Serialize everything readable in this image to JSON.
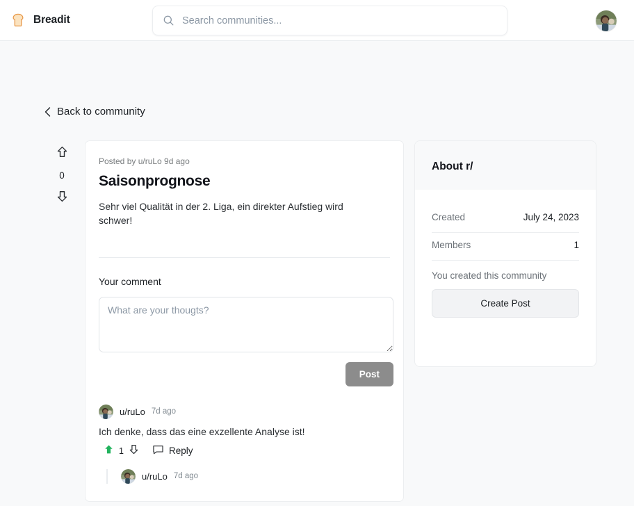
{
  "header": {
    "brand_name": "Breadit",
    "brand_icon": "bread-slice-icon",
    "search_placeholder": "Search communities...",
    "search_value": "",
    "search_icon": "search-icon",
    "avatar": "user-avatar"
  },
  "nav": {
    "back_label": "Back to community",
    "back_icon": "chevron-left-icon"
  },
  "post": {
    "vote_count": "0",
    "upvote_icon": "arrow-up-icon",
    "downvote_icon": "arrow-down-icon",
    "meta": "Posted by u/ruLo 9d ago",
    "title": "Saisonprognose",
    "body": "Sehr viel Qualität in der 2. Liga, ein direkter Aufstieg wird schwer!"
  },
  "comment_form": {
    "label": "Your comment",
    "placeholder": "What are your thougts?",
    "value": "",
    "submit_label": "Post",
    "submit_disabled_color": "#8c8c8c"
  },
  "comments": [
    {
      "user": "u/ruLo",
      "time": "7d ago",
      "text": "Ich denke, dass das eine exzellente Analyse ist!",
      "votes": "1",
      "upvoted": true,
      "upvote_color": "#22b35e",
      "reply_label": "Reply",
      "reply_icon": "comment-bubble-icon"
    },
    {
      "user": "u/ruLo",
      "time": "7d ago",
      "text": "",
      "nested": true
    }
  ],
  "sidebar": {
    "title": "About r/",
    "rows": [
      {
        "key": "Created",
        "value": "July 24, 2023"
      },
      {
        "key": "Members",
        "value": "1"
      }
    ],
    "note": "You created this community",
    "create_post_label": "Create Post"
  },
  "colors": {
    "page_bg": "#f8f9fa",
    "card_bg": "#ffffff",
    "border": "#eceef0",
    "text": "#1c2024",
    "muted": "#787c7e",
    "accent_green": "#22b35e"
  }
}
